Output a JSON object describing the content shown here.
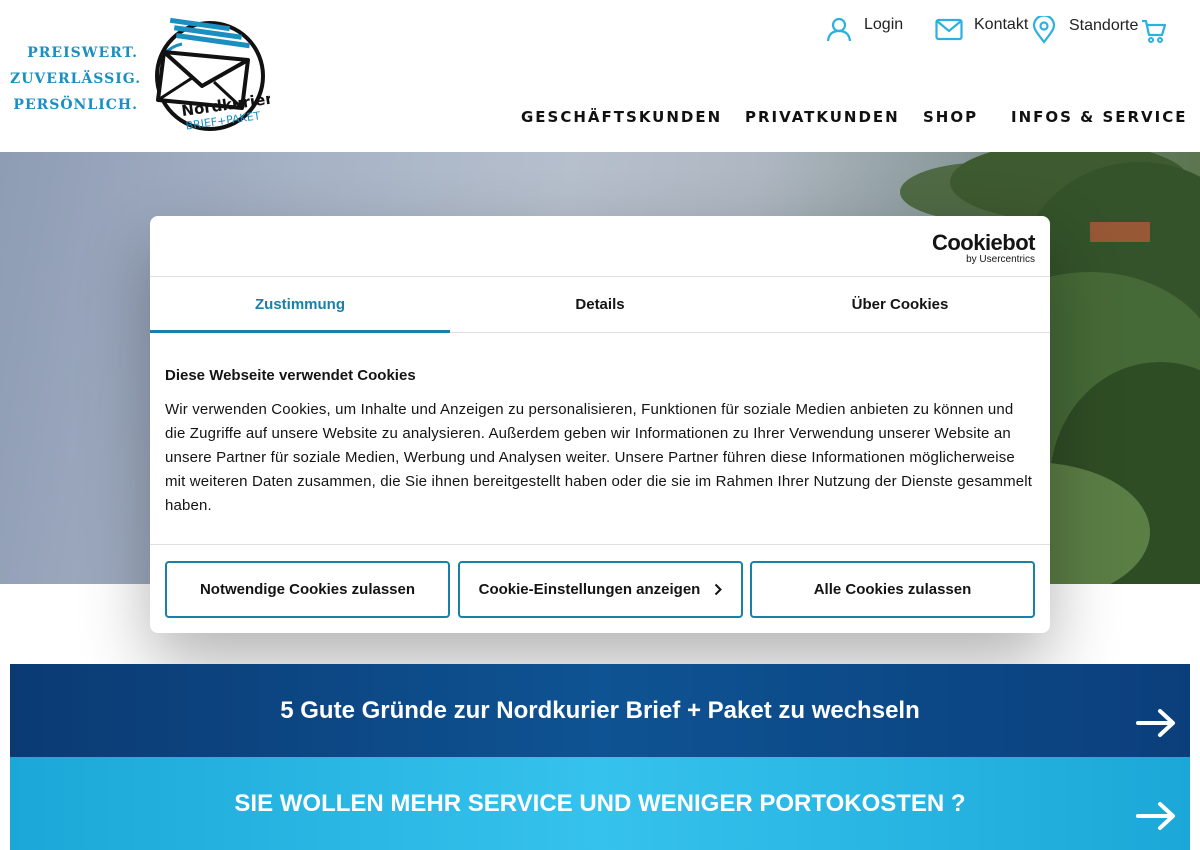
{
  "header": {
    "slogan": [
      "PREISWERT.",
      "ZUVERLÄSSIG.",
      "PERSÖNLICH."
    ],
    "logo_brand": "Nordkurier",
    "logo_sub": "BRIEF+PAKET",
    "topnav": {
      "login": "Login",
      "kontakt": "Kontakt",
      "standorte": "Standorte"
    },
    "mainnav": [
      "GESCHÄFTSKUNDEN",
      "PRIVATKUNDEN",
      "SHOP",
      "INFOS & SERVICE"
    ]
  },
  "cookie_dialog": {
    "provider_name": "Cookiebot",
    "provider_sub": "by Usercentrics",
    "tabs": [
      "Zustimmung",
      "Details",
      "Über Cookies"
    ],
    "active_tab": "Zustimmung",
    "heading": "Diese Webseite verwendet Cookies",
    "body": "Wir verwenden Cookies, um Inhalte und Anzeigen zu personalisieren, Funktionen für soziale Medien anbieten zu können und die Zugriffe auf unsere Website zu analysieren. Außerdem geben wir Informationen zu Ihrer Verwendung unserer Website an unsere Partner für soziale Medien, Werbung und Analysen weiter. Unsere Partner führen diese Informationen möglicherweise mit weiteren Daten zusammen, die Sie ihnen bereitgestellt haben oder die sie im Rahmen Ihrer Nutzung der Dienste gesammelt haben.",
    "buttons": {
      "necessary": "Notwendige Cookies zulassen",
      "settings": "Cookie-Einstellungen anzeigen",
      "all": "Alle Cookies zulassen"
    }
  },
  "banners": [
    "5 Gute Gründe zur Nordkurier Brief + Paket zu wechseln",
    "SIE WOLLEN MEHR SERVICE UND WENIGER PORTOKOSTEN ?"
  ],
  "colors": {
    "accent": "#1a80a8",
    "slogan": "#1a8fc0",
    "icon": "#2bb0e0",
    "banner_dark": "#0e5393",
    "banner_light": "#35c2ec"
  }
}
